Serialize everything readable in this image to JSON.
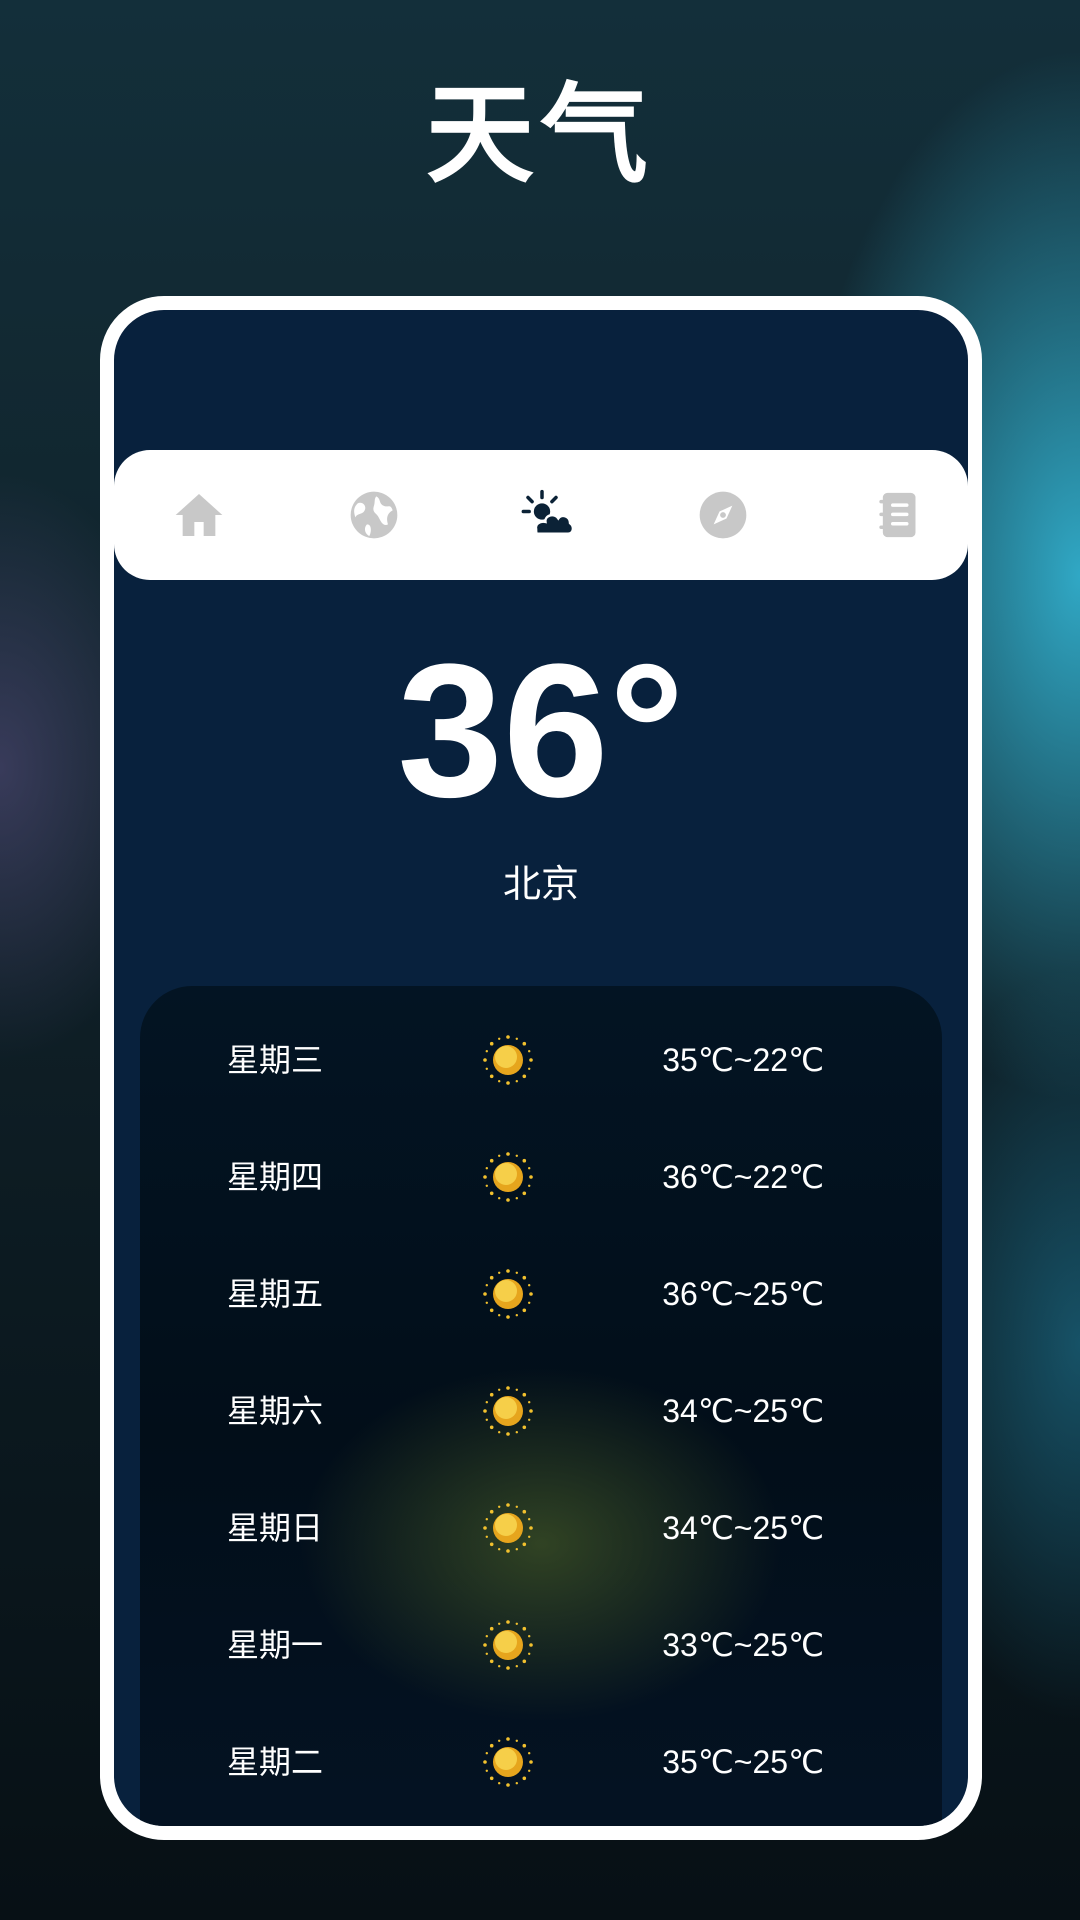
{
  "page": {
    "title": "天气"
  },
  "colors": {
    "accent": "#08213d",
    "nav_inactive": "#c8c8c8",
    "nav_active": "#0b2236",
    "sun": "#f2c12e"
  },
  "nav": {
    "items": [
      {
        "name": "home",
        "icon": "home-icon",
        "active": false
      },
      {
        "name": "globe",
        "icon": "globe-icon",
        "active": false
      },
      {
        "name": "weather",
        "icon": "partly-sunny-icon",
        "active": true
      },
      {
        "name": "compass",
        "icon": "compass-icon",
        "active": false
      },
      {
        "name": "notes",
        "icon": "notebook-icon",
        "active": false
      }
    ]
  },
  "current": {
    "temperature": "36°",
    "city": "北京"
  },
  "forecast": [
    {
      "day": "星期三",
      "icon": "sun-icon",
      "range": "35℃~22℃"
    },
    {
      "day": "星期四",
      "icon": "sun-icon",
      "range": "36℃~22℃"
    },
    {
      "day": "星期五",
      "icon": "sun-icon",
      "range": "36℃~25℃"
    },
    {
      "day": "星期六",
      "icon": "sun-icon",
      "range": "34℃~25℃"
    },
    {
      "day": "星期日",
      "icon": "sun-icon",
      "range": "34℃~25℃"
    },
    {
      "day": "星期一",
      "icon": "sun-icon",
      "range": "33℃~25℃"
    },
    {
      "day": "星期二",
      "icon": "sun-icon",
      "range": "35℃~25℃"
    }
  ]
}
